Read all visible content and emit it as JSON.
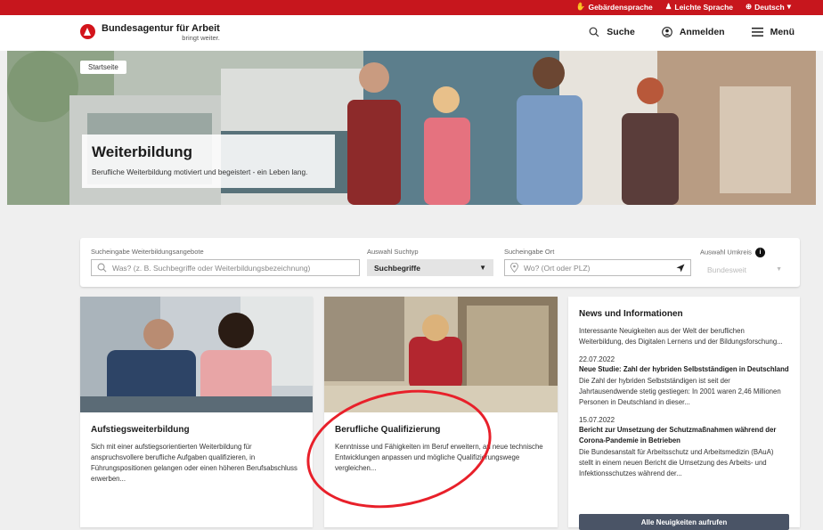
{
  "topbar": {
    "links": [
      {
        "icon": "sign-language-icon",
        "glyph": "✋",
        "label": "Gebärdensprache"
      },
      {
        "icon": "easy-language-icon",
        "glyph": "♟",
        "label": "Leichte Sprache"
      },
      {
        "icon": "globe-icon",
        "glyph": "⊕",
        "label": "Deutsch",
        "caret": "▾"
      }
    ]
  },
  "header": {
    "logo_name": "Bundesagentur für Arbeit",
    "logo_tagline": "bringt weiter.",
    "nav": {
      "search": "Suche",
      "login": "Anmelden",
      "menu": "Menü"
    }
  },
  "hero": {
    "breadcrumb": "Startseite",
    "title": "Weiterbildung",
    "subtitle": "Berufliche Weiterbildung motiviert und begeistert - ein Leben lang."
  },
  "search": {
    "query_label": "Sucheingabe Weiterbildungsangebote",
    "query_placeholder": "Was? (z. B. Suchbegriffe oder Weiterbildungsbezeichnung)",
    "type_label": "Auswahl Suchtyp",
    "type_value": "Suchbegriffe",
    "location_label": "Sucheingabe Ort",
    "location_placeholder": "Wo? (Ort oder PLZ)",
    "radius_label": "Auswahl Umkreis",
    "radius_value": "Bundesweit"
  },
  "cards": [
    {
      "title": "Aufstiegsweiterbildung",
      "text": "Sich mit einer aufstiegsorientierten Weiterbildung für anspruchsvollere berufliche Aufgaben qualifizieren, in Führungspositionen gelangen oder einen höheren Berufsabschluss erwerben..."
    },
    {
      "title": "Berufliche Qualifizierung",
      "text": "Kenntnisse und Fähigkeiten im Beruf erweitern, an neue technische Entwicklungen anpassen und mögliche Qualifizierungswege vergleichen..."
    }
  ],
  "news": {
    "title": "News und Informationen",
    "intro": "Interessante Neuigkeiten aus der Welt der beruflichen Weiterbildung, des Digitalen Lernens und der Bildungsforschung...",
    "items": [
      {
        "date": "22.07.2022",
        "headline": "Neue Studie: Zahl der hybriden Selbstständigen in Deutschland",
        "text": "Die Zahl der hybriden Selbstständigen ist seit der Jahrtausendwende stetig gestiegen: In 2001 waren 2,46 Millionen Personen in Deutschland in dieser..."
      },
      {
        "date": "15.07.2022",
        "headline": "Bericht zur Umsetzung der Schutzmaßnahmen während der Corona-Pandemie in Betrieben",
        "text": "Die Bundesanstalt für Arbeitsschutz und Arbeitsmedizin (BAuA) stellt in einem neuen Bericht die Umsetzung des Arbeits- und Infektionsschutzes während der..."
      }
    ],
    "button": "Alle Neuigkeiten aufrufen"
  },
  "colors": {
    "brand_red": "#c7161d",
    "button": "#4a5466",
    "annotation": "#e8202a"
  }
}
